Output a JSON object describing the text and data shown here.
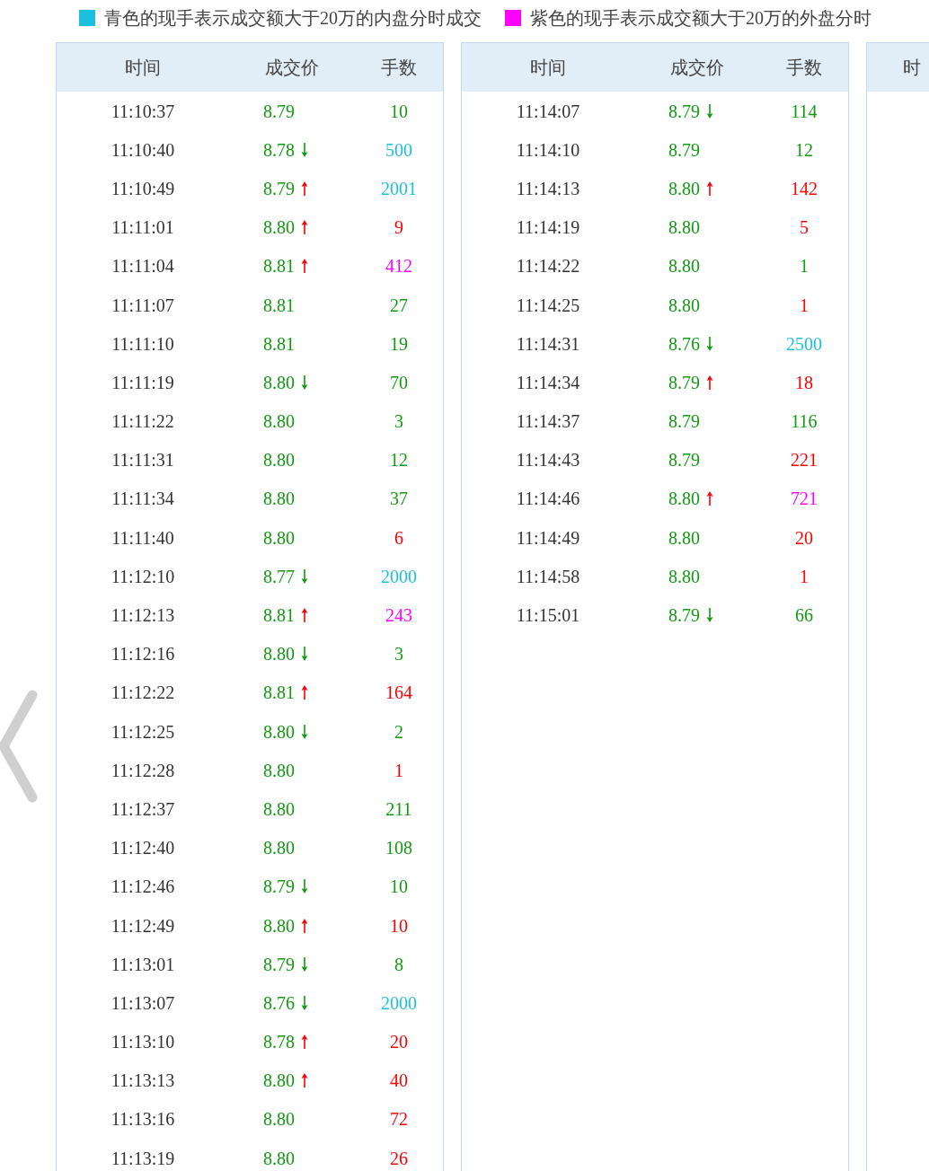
{
  "legend": [
    {
      "color": "#1cc0de",
      "text": "青色的现手表示成交额大于20万的内盘分时成交"
    },
    {
      "color": "#ff00ff",
      "text": "紫色的现手表示成交额大于20万的外盘分时"
    }
  ],
  "panels": [
    {
      "columns": [
        "时间",
        "成交价",
        "手数"
      ],
      "rows": [
        {
          "time": "11:10:37",
          "price": "8.79",
          "arrow": false,
          "volume": "10",
          "color": "#129a12"
        },
        {
          "time": "11:10:40",
          "price": "8.78",
          "arrow": true,
          "up": false,
          "volume": "500",
          "color": "#1cc0de"
        },
        {
          "time": "11:10:49",
          "price": "8.79",
          "arrow": true,
          "up": true,
          "volume": "2001",
          "color": "#1cc0de"
        },
        {
          "time": "11:11:01",
          "price": "8.80",
          "arrow": true,
          "up": true,
          "volume": "9",
          "color": "#ff0000"
        },
        {
          "time": "11:11:04",
          "price": "8.81",
          "arrow": true,
          "up": true,
          "volume": "412",
          "color": "#ff00ff"
        },
        {
          "time": "11:11:07",
          "price": "8.81",
          "arrow": false,
          "volume": "27",
          "color": "#129a12"
        },
        {
          "time": "11:11:10",
          "price": "8.81",
          "arrow": false,
          "volume": "19",
          "color": "#129a12"
        },
        {
          "time": "11:11:19",
          "price": "8.80",
          "arrow": true,
          "up": false,
          "volume": "70",
          "color": "#129a12"
        },
        {
          "time": "11:11:22",
          "price": "8.80",
          "arrow": false,
          "volume": "3",
          "color": "#129a12"
        },
        {
          "time": "11:11:31",
          "price": "8.80",
          "arrow": false,
          "volume": "12",
          "color": "#129a12"
        },
        {
          "time": "11:11:34",
          "price": "8.80",
          "arrow": false,
          "volume": "37",
          "color": "#129a12"
        },
        {
          "time": "11:11:40",
          "price": "8.80",
          "arrow": false,
          "volume": "6",
          "color": "#ff0000"
        },
        {
          "time": "11:12:10",
          "price": "8.77",
          "arrow": true,
          "up": false,
          "volume": "2000",
          "color": "#1cc0de"
        },
        {
          "time": "11:12:13",
          "price": "8.81",
          "arrow": true,
          "up": true,
          "volume": "243",
          "color": "#ff00ff"
        },
        {
          "time": "11:12:16",
          "price": "8.80",
          "arrow": true,
          "up": false,
          "volume": "3",
          "color": "#129a12"
        },
        {
          "time": "11:12:22",
          "price": "8.81",
          "arrow": true,
          "up": true,
          "volume": "164",
          "color": "#ff0000"
        },
        {
          "time": "11:12:25",
          "price": "8.80",
          "arrow": true,
          "up": false,
          "volume": "2",
          "color": "#129a12"
        },
        {
          "time": "11:12:28",
          "price": "8.80",
          "arrow": false,
          "volume": "1",
          "color": "#ff0000"
        },
        {
          "time": "11:12:37",
          "price": "8.80",
          "arrow": false,
          "volume": "211",
          "color": "#129a12"
        },
        {
          "time": "11:12:40",
          "price": "8.80",
          "arrow": false,
          "volume": "108",
          "color": "#129a12"
        },
        {
          "time": "11:12:46",
          "price": "8.79",
          "arrow": true,
          "up": false,
          "volume": "10",
          "color": "#129a12"
        },
        {
          "time": "11:12:49",
          "price": "8.80",
          "arrow": true,
          "up": true,
          "volume": "10",
          "color": "#ff0000"
        },
        {
          "time": "11:13:01",
          "price": "8.79",
          "arrow": true,
          "up": false,
          "volume": "8",
          "color": "#129a12"
        },
        {
          "time": "11:13:07",
          "price": "8.76",
          "arrow": true,
          "up": false,
          "volume": "2000",
          "color": "#1cc0de"
        },
        {
          "time": "11:13:10",
          "price": "8.78",
          "arrow": true,
          "up": true,
          "volume": "20",
          "color": "#ff0000"
        },
        {
          "time": "11:13:13",
          "price": "8.80",
          "arrow": true,
          "up": true,
          "volume": "40",
          "color": "#ff0000"
        },
        {
          "time": "11:13:16",
          "price": "8.80",
          "arrow": false,
          "volume": "72",
          "color": "#ff0000"
        },
        {
          "time": "11:13:19",
          "price": "8.80",
          "arrow": false,
          "volume": "26",
          "color": "#ff0000"
        }
      ]
    },
    {
      "columns": [
        "时间",
        "成交价",
        "手数"
      ],
      "rows": [
        {
          "time": "11:14:07",
          "price": "8.79",
          "arrow": true,
          "up": false,
          "volume": "114",
          "color": "#129a12"
        },
        {
          "time": "11:14:10",
          "price": "8.79",
          "arrow": false,
          "volume": "12",
          "color": "#129a12"
        },
        {
          "time": "11:14:13",
          "price": "8.80",
          "arrow": true,
          "up": true,
          "volume": "142",
          "color": "#ff0000"
        },
        {
          "time": "11:14:19",
          "price": "8.80",
          "arrow": false,
          "volume": "5",
          "color": "#ff0000"
        },
        {
          "time": "11:14:22",
          "price": "8.80",
          "arrow": false,
          "volume": "1",
          "color": "#129a12"
        },
        {
          "time": "11:14:25",
          "price": "8.80",
          "arrow": false,
          "volume": "1",
          "color": "#ff0000"
        },
        {
          "time": "11:14:31",
          "price": "8.76",
          "arrow": true,
          "up": false,
          "volume": "2500",
          "color": "#1cc0de"
        },
        {
          "time": "11:14:34",
          "price": "8.79",
          "arrow": true,
          "up": true,
          "volume": "18",
          "color": "#ff0000"
        },
        {
          "time": "11:14:37",
          "price": "8.79",
          "arrow": false,
          "volume": "116",
          "color": "#129a12"
        },
        {
          "time": "11:14:43",
          "price": "8.79",
          "arrow": false,
          "volume": "221",
          "color": "#ff0000"
        },
        {
          "time": "11:14:46",
          "price": "8.80",
          "arrow": true,
          "up": true,
          "volume": "721",
          "color": "#ff00ff"
        },
        {
          "time": "11:14:49",
          "price": "8.80",
          "arrow": false,
          "volume": "20",
          "color": "#ff0000"
        },
        {
          "time": "11:14:58",
          "price": "8.80",
          "arrow": false,
          "volume": "1",
          "color": "#ff0000"
        },
        {
          "time": "11:15:01",
          "price": "8.79",
          "arrow": true,
          "up": false,
          "volume": "66",
          "color": "#129a12"
        }
      ]
    },
    {
      "columns": [
        "时"
      ]
    }
  ]
}
